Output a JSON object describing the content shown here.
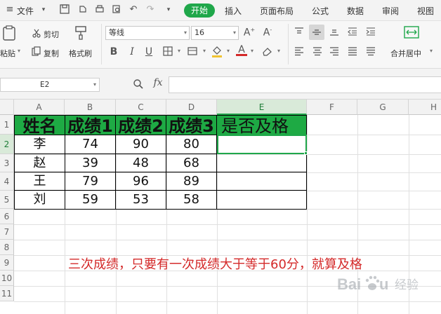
{
  "menubar": {
    "file": "文件",
    "tabs": [
      "开始",
      "插入",
      "页面布局",
      "公式",
      "数据",
      "审阅",
      "视图"
    ]
  },
  "ribbon": {
    "paste": "粘贴",
    "cut": "剪切",
    "copy": "复制",
    "format_painter": "格式刷",
    "font_name": "等线",
    "font_size": "16",
    "merge_center": "合并居中"
  },
  "formula_bar": {
    "name_box": "E2",
    "fx": "fx",
    "value": ""
  },
  "sheet": {
    "columns": [
      "A",
      "B",
      "C",
      "D",
      "E",
      "F",
      "G",
      "H"
    ],
    "selected_column": "E",
    "rows": [
      "1",
      "2",
      "3",
      "4",
      "5",
      "6",
      "7",
      "8",
      "9",
      "10",
      "11"
    ],
    "selected_row": "2",
    "header": [
      "姓名",
      "成绩1",
      "成绩2",
      "成绩3",
      "是否及格"
    ],
    "data": [
      [
        "李",
        "74",
        "90",
        "80",
        ""
      ],
      [
        "赵",
        "39",
        "48",
        "68",
        ""
      ],
      [
        "王",
        "79",
        "96",
        "89",
        ""
      ],
      [
        "刘",
        "59",
        "53",
        "58",
        ""
      ]
    ],
    "active_cell": "E2",
    "note": "三次成绩，只要有一次成绩大于等于60分，就算及格"
  },
  "watermark": {
    "brand": "Baidu",
    "subtitle": "经验"
  },
  "colors": {
    "accent": "#1fa74a",
    "header_fill": "#1eaa44",
    "note": "#d42a2a"
  }
}
